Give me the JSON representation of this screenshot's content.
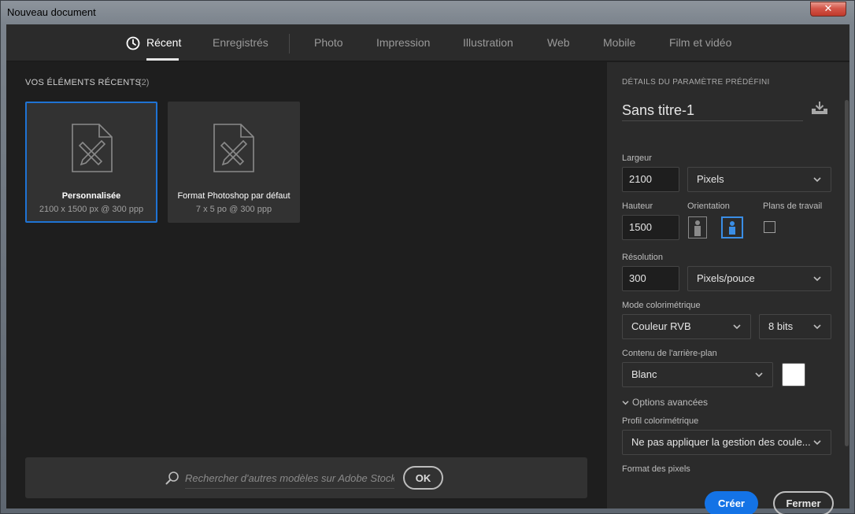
{
  "window": {
    "title": "Nouveau document",
    "close_glyph": "✕"
  },
  "tabs": [
    {
      "label": "Récent",
      "active": true,
      "icon": "clock-icon"
    },
    {
      "label": "Enregistrés"
    },
    {
      "label": "Photo"
    },
    {
      "label": "Impression"
    },
    {
      "label": "Illustration"
    },
    {
      "label": "Web"
    },
    {
      "label": "Mobile"
    },
    {
      "label": "Film et vidéo"
    }
  ],
  "recent": {
    "title": "VOS ÉLÉMENTS RÉCENTS",
    "count": "(2)",
    "items": [
      {
        "name": "Personnalisée",
        "info": "2100 x 1500 px @ 300 ppp",
        "selected": true,
        "icon": "document-pencil-icon"
      },
      {
        "name": "Format Photoshop par défaut",
        "info": "7 x 5 po @ 300 ppp",
        "selected": false,
        "icon": "document-pencil-icon"
      }
    ]
  },
  "search": {
    "placeholder": "Rechercher d'autres modèles sur Adobe Stock",
    "ok_label": "OK",
    "icon": "search-icon"
  },
  "preset": {
    "title": "DÉTAILS DU PARAMÈTRE PRÉDÉFINI",
    "doc_name": "Sans titre-1",
    "save_icon": "save-preset-icon",
    "width_label": "Largeur",
    "width_value": "2100",
    "width_unit": "Pixels",
    "height_label": "Hauteur",
    "height_value": "1500",
    "orientation_label": "Orientation",
    "orientation_selected": "landscape",
    "artboards_label": "Plans de travail",
    "artboards_checked": false,
    "resolution_label": "Résolution",
    "resolution_value": "300",
    "resolution_unit": "Pixels/pouce",
    "color_mode_label": "Mode colorimétrique",
    "color_mode": "Couleur RVB",
    "bit_depth": "8 bits",
    "background_label": "Contenu de l'arrière-plan",
    "background": "Blanc",
    "background_color": "#ffffff",
    "advanced_label": "Options avancées",
    "profile_label": "Profil colorimétrique",
    "profile": "Ne pas appliquer la gestion des coule...",
    "pixel_format_label": "Format des pixels",
    "create_label": "Créer",
    "close_label": "Fermer"
  },
  "colors": {
    "accent": "#1473e6",
    "selected_border": "#1f73d4",
    "panel": "#2b2b2b",
    "background": "#1e1e1e"
  }
}
